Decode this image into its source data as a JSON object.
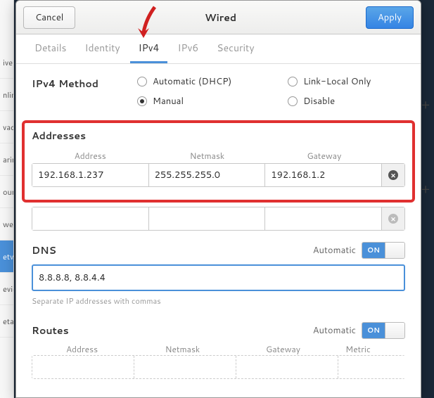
{
  "titlebar": {
    "cancel": "Cancel",
    "title": "Wired",
    "apply": "Apply"
  },
  "tabs": [
    "Details",
    "Identity",
    "IPv4",
    "IPv6",
    "Security"
  ],
  "active_tab": 2,
  "method": {
    "label": "IPv4 Method",
    "options": {
      "auto": "Automatic (DHCP)",
      "manual": "Manual",
      "linklocal": "Link-Local Only",
      "disable": "Disable"
    },
    "selected": "manual"
  },
  "addresses": {
    "title": "Addresses",
    "headers": {
      "address": "Address",
      "netmask": "Netmask",
      "gateway": "Gateway"
    },
    "rows": [
      {
        "address": "192.168.1.237",
        "netmask": "255.255.255.0",
        "gateway": "192.168.1.2"
      },
      {
        "address": "",
        "netmask": "",
        "gateway": ""
      }
    ]
  },
  "dns": {
    "title": "DNS",
    "auto_label": "Automatic",
    "switch_on": "ON",
    "value": "8.8.8.8, 8.8.4.4",
    "hint": "Separate IP addresses with commas"
  },
  "routes": {
    "title": "Routes",
    "auto_label": "Automatic",
    "switch_on": "ON",
    "headers": {
      "address": "Address",
      "netmask": "Netmask",
      "gateway": "Gateway",
      "metric": "Metric"
    }
  },
  "bg_sidebar": [
    "ive",
    "nlin",
    "vac",
    "arin",
    "oun",
    "we",
    "etw",
    "evic",
    "etail"
  ]
}
